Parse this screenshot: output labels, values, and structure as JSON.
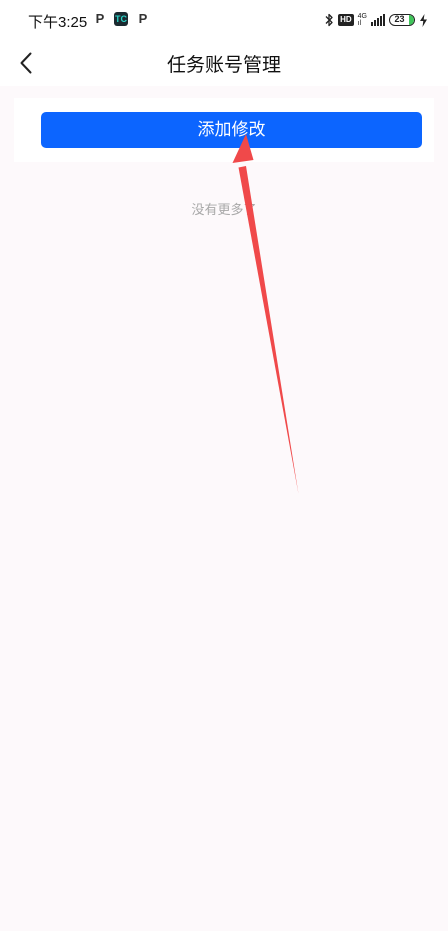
{
  "status_bar": {
    "time": "下午3:25",
    "apps": [
      "P",
      "TC",
      "P"
    ],
    "hd_badge": "HD",
    "network_top": "4G",
    "network_bottom": "ıl",
    "battery_level": "23",
    "icons": [
      "bluetooth-icon",
      "signal-icon",
      "battery-icon",
      "charging-icon"
    ]
  },
  "header": {
    "title": "任务账号管理",
    "back_icon": "chevron-left-icon"
  },
  "main": {
    "add_button_label": "添加修改",
    "footer_note": "没有更多了"
  },
  "colors": {
    "primary": "#0c65ff",
    "background": "#fdf9fb",
    "annotation_arrow": "#f0494a"
  }
}
